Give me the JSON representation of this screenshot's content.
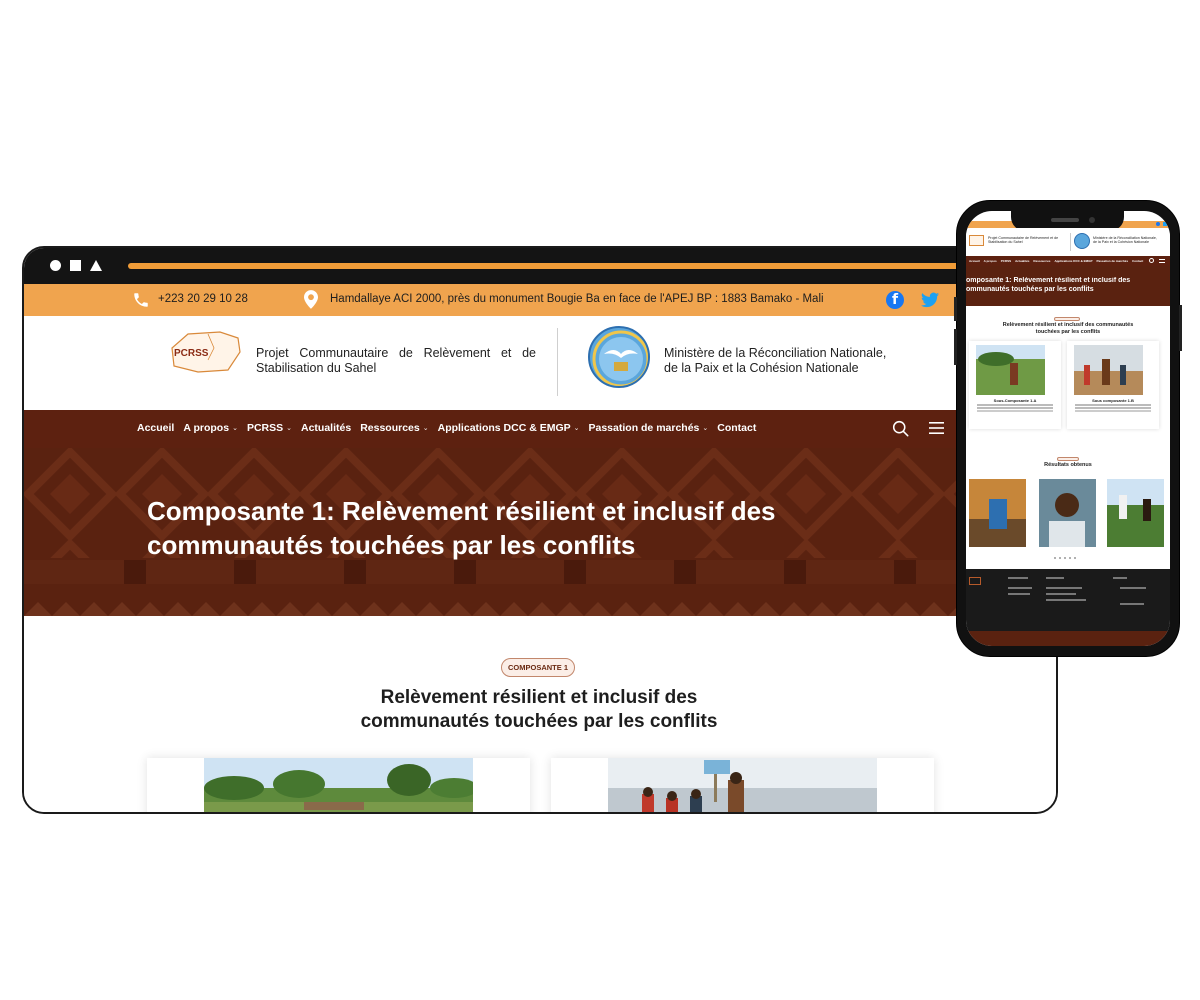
{
  "topbar": {
    "phone": "+223 20 29 10 28",
    "address": "Hamdallaye ACI 2000, près du monument Bougie Ba en face de l'APEJ BP : 1883 Bamako - Mali"
  },
  "header": {
    "logo_text": "PCRSS",
    "project_name": "Projet Communautaire de Relèvement et de Stabilisation du Sahel",
    "ministry_name_line1": "Ministère de la Réconciliation Nationale,",
    "ministry_name_line2": "de la Paix et la Cohésion Nationale"
  },
  "nav": {
    "items": [
      {
        "label": "Accueil",
        "dropdown": false
      },
      {
        "label": "A propos",
        "dropdown": true
      },
      {
        "label": "PCRSS",
        "dropdown": true
      },
      {
        "label": "Actualités",
        "dropdown": false
      },
      {
        "label": "Ressources",
        "dropdown": true
      },
      {
        "label": "Applications DCC & EMGP",
        "dropdown": true
      },
      {
        "label": "Passation de marchés",
        "dropdown": true
      },
      {
        "label": "Contact",
        "dropdown": false
      }
    ],
    "chevron": "⌄"
  },
  "hero": {
    "title_line1": "Composante 1: Relèvement résilient et inclusif des",
    "title_line2": "communautés touchées par les conflits"
  },
  "section": {
    "badge": "COMPOSANTE 1",
    "title_line1": "Relèvement résilient et inclusif des",
    "title_line2": "communautés touchées par les conflits"
  },
  "phone": {
    "hero_title_line1": "omposante 1: Relèvement résilient et inclusif des",
    "hero_title_line2": "ommunautés touchées par les conflits",
    "section_title": "Relèvement résilient et inclusif des communautés touchées par les conflits",
    "card1_title": "Sous-Composante 1.A",
    "card2_title": "Sous composante 1.B",
    "results_title": "Résultats obtenus"
  },
  "colors": {
    "accent_orange": "#f0a44e",
    "brand_brown": "#5d2110",
    "hero_brown": "#5a2210",
    "facebook": "#1877f2",
    "twitter": "#1da1f2"
  },
  "icons": [
    "phone-icon",
    "location-pin-icon",
    "facebook-icon",
    "twitter-icon",
    "search-icon",
    "hamburger-menu-icon",
    "chevron-down-icon"
  ]
}
